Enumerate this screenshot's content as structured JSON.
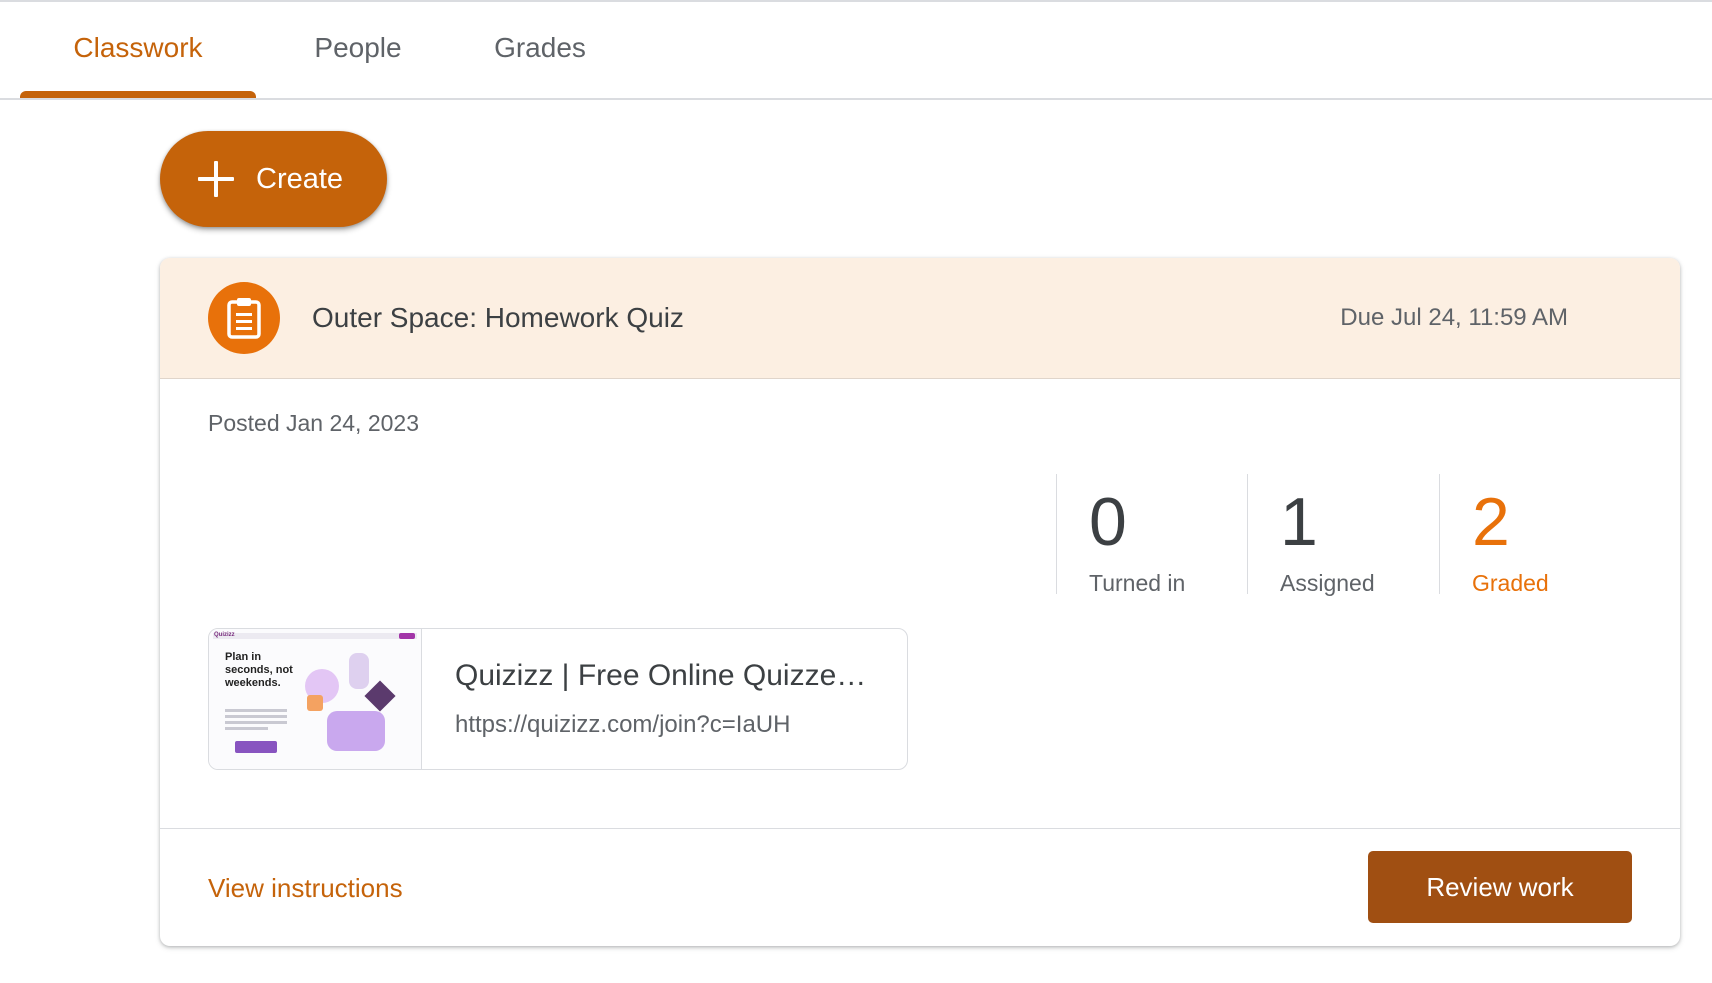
{
  "tabs": [
    {
      "label": "Classwork",
      "active": true
    },
    {
      "label": "People",
      "active": false
    },
    {
      "label": "Grades",
      "active": false
    }
  ],
  "create_button": {
    "label": "Create",
    "icon": "plus-icon"
  },
  "assignment": {
    "icon": "assignment-icon",
    "title": "Outer Space: Homework Quiz",
    "due": "Due Jul 24, 11:59 AM",
    "posted": "Posted Jan 24, 2023",
    "stats": [
      {
        "value": "0",
        "label": "Turned in"
      },
      {
        "value": "1",
        "label": "Assigned"
      },
      {
        "value": "2",
        "label": "Graded"
      }
    ],
    "attachment": {
      "title": "Quizizz | Free Online Quizzes for Every Student",
      "url": "https://quizizz.com/join?c=IaUH",
      "thumbnail": {
        "brand": "Quizizz",
        "headline": "Plan in seconds, not weekends."
      }
    },
    "footer": {
      "view_instructions": "View instructions",
      "review_work": "Review work"
    }
  },
  "colors": {
    "accent": "#c5630a",
    "graded": "#e8710a",
    "header_bg": "#fcefe2",
    "review_button": "#a04f12"
  }
}
